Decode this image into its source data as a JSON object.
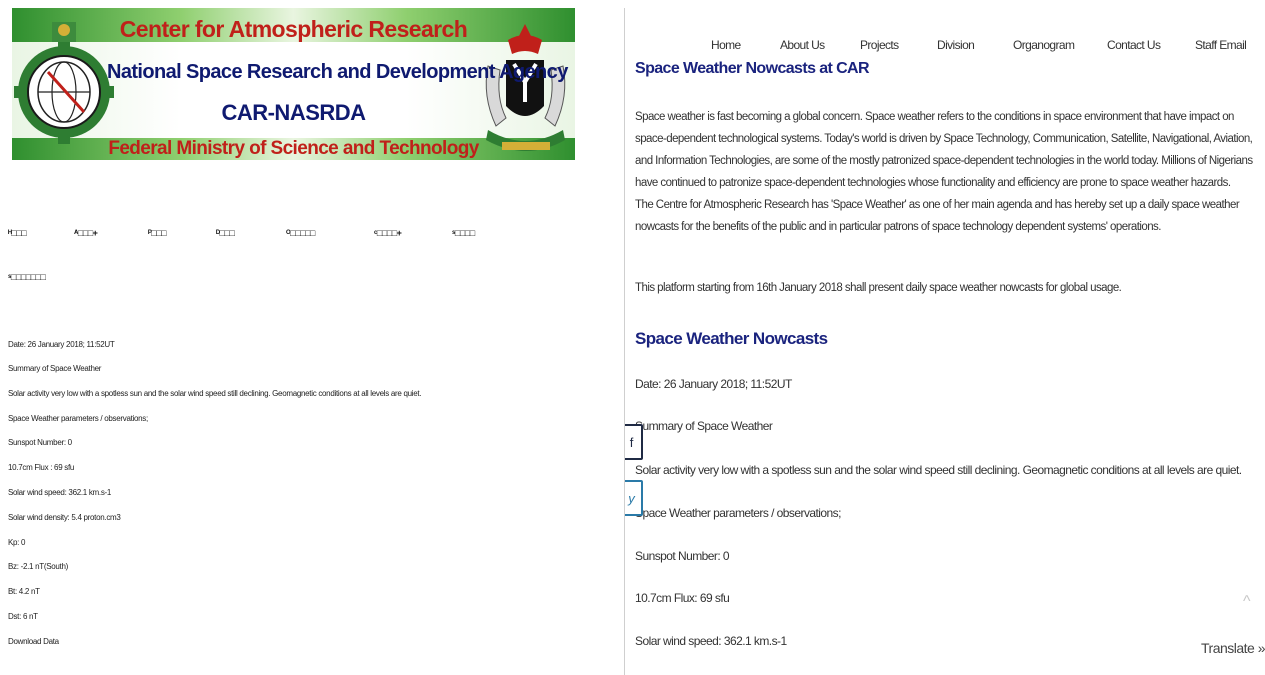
{
  "banner": {
    "line1": "Center for Atmospheric Research",
    "line2": "National Space Research and Development Agency",
    "line3": "CAR-NASRDA",
    "line4": "Federal Ministry of Science and Technology",
    "colors": {
      "red": "#c0201a",
      "navy": "#0f1a70",
      "green": "#2f8f2f"
    }
  },
  "left_nav": {
    "items": [
      "ᴴ□□□",
      "ᴬ□□□+",
      "ᴾ□□□",
      "ᴰ□□□",
      "ᴼ□□□□□",
      "ᶜ□□□□+",
      "ˢ□□□□"
    ],
    "second_row": "ˢ□□□□□□□"
  },
  "left_content": {
    "date": "Date: 26 January 2018; 11:52UT",
    "summary_label": "Summary of Space Weather",
    "summary": "Solar activity very low with a spotless sun and the solar wind speed still declining. Geomagnetic conditions at all levels are quiet.",
    "params_label": "Space Weather parameters / observations;",
    "sunspot": "Sunspot Number: 0",
    "flux": "10.7cm Flux : 69 sfu",
    "wind_speed": "Solar wind speed: 362.1 km.s-1",
    "wind_density": "Solar wind density: 5.4 proton.cm3",
    "kp": "Kp: 0",
    "bz": "Bz: -2.1 nT(South)",
    "bt": "Bt: 4.2 nT",
    "dst": "Dst: 6 nT",
    "download": "Download Data"
  },
  "right_nav": {
    "items": [
      "Home",
      "About Us",
      "Projects",
      "Division",
      "Organogram",
      "Contact Us",
      "Staff Email"
    ]
  },
  "right_content": {
    "title": "Space Weather Nowcasts at CAR",
    "para1": "Space weather is fast becoming a global concern. Space weather refers to the conditions in space environment that have impact on space-dependent technological systems. Today's world is driven by Space Technology, Communication, Satellite, Navigational, Aviation, and Information Technologies, are some of the mostly patronized space-dependent technologies in the world today. Millions of Nigerians have continued to patronize space-dependent technologies whose functionality and efficiency are prone to space weather hazards.",
    "para2": "The Centre for Atmospheric Research has 'Space Weather' as one of her main agenda and has hereby set up a daily space weather nowcasts for the benefits of the public and in particular patrons of space technology dependent systems' operations.",
    "para3": "This platform starting from 16th January 2018 shall present daily space weather nowcasts for global usage.",
    "heading2": "Space Weather Nowcasts",
    "date": "Date: 26 January 2018; 11:52UT",
    "summary_label": "Summary of Space Weather",
    "summary": "Solar activity very low with a spotless sun and the solar wind speed still declining. Geomagnetic conditions at all levels are quiet.",
    "params_label": "Space Weather parameters / observations;",
    "sunspot": "Sunspot Number: 0",
    "flux": "10.7cm Flux: 69 sfu",
    "wind_speed": "Solar wind speed: 362.1 km.s-1"
  },
  "widgets": {
    "facebook_icon": "f",
    "twitter_icon": "y",
    "scroll_top_icon": "^",
    "translate": "Translate »"
  }
}
